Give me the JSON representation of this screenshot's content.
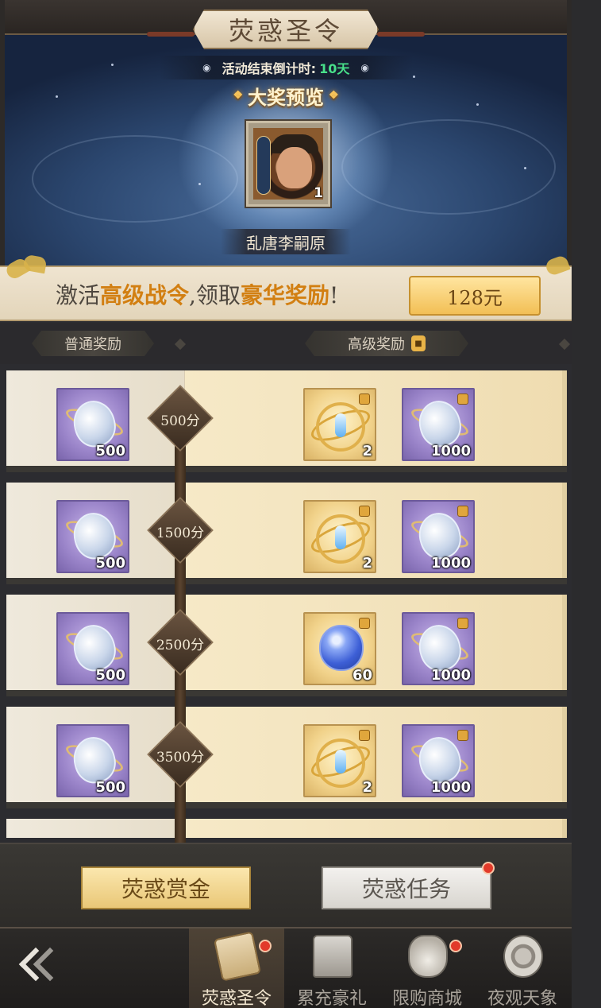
{
  "header": {
    "title": "荧惑圣令",
    "countdown_label": "活动结束倒计时:",
    "countdown_value": "10天"
  },
  "grand_prize": {
    "title": "大奖预览",
    "hero_name": "乱唐李嗣原",
    "quantity": "1"
  },
  "premium": {
    "text_before": "激活",
    "highlight1": "高级战令",
    "text_mid": ",领取",
    "highlight2": "豪华奖励",
    "text_after": "!",
    "price_label": "128元"
  },
  "columns": {
    "free_label": "普通奖励",
    "premium_label": "高级奖励"
  },
  "rows": [
    {
      "milestone": "500分",
      "free": {
        "icon": "shield-icon",
        "qty": "500"
      },
      "prem1": {
        "icon": "orb-icon",
        "qty": "2"
      },
      "prem2": {
        "icon": "shield-icon",
        "qty": "1000"
      }
    },
    {
      "milestone": "1500分",
      "free": {
        "icon": "shield-icon",
        "qty": "500"
      },
      "prem1": {
        "icon": "orb-icon",
        "qty": "2"
      },
      "prem2": {
        "icon": "shield-icon",
        "qty": "1000"
      }
    },
    {
      "milestone": "2500分",
      "free": {
        "icon": "shield-icon",
        "qty": "500"
      },
      "prem1": {
        "icon": "gem-icon",
        "qty": "60"
      },
      "prem2": {
        "icon": "shield-icon",
        "qty": "1000"
      }
    },
    {
      "milestone": "3500分",
      "free": {
        "icon": "shield-icon",
        "qty": "500"
      },
      "prem1": {
        "icon": "orb-icon",
        "qty": "2"
      },
      "prem2": {
        "icon": "shield-icon",
        "qty": "1000"
      }
    }
  ],
  "actions": {
    "bounty_label": "荧惑赏金",
    "tasks_label": "荧惑任务"
  },
  "nav": [
    {
      "label": "荧惑圣令",
      "icon": "scroll-icon",
      "active": true,
      "badge": true
    },
    {
      "label": "累充豪礼",
      "icon": "chest-icon",
      "active": false,
      "badge": false
    },
    {
      "label": "限购商城",
      "icon": "bag-icon",
      "active": false,
      "badge": true
    },
    {
      "label": "夜观天象",
      "icon": "astrolabe-icon",
      "active": false,
      "badge": false
    }
  ]
}
